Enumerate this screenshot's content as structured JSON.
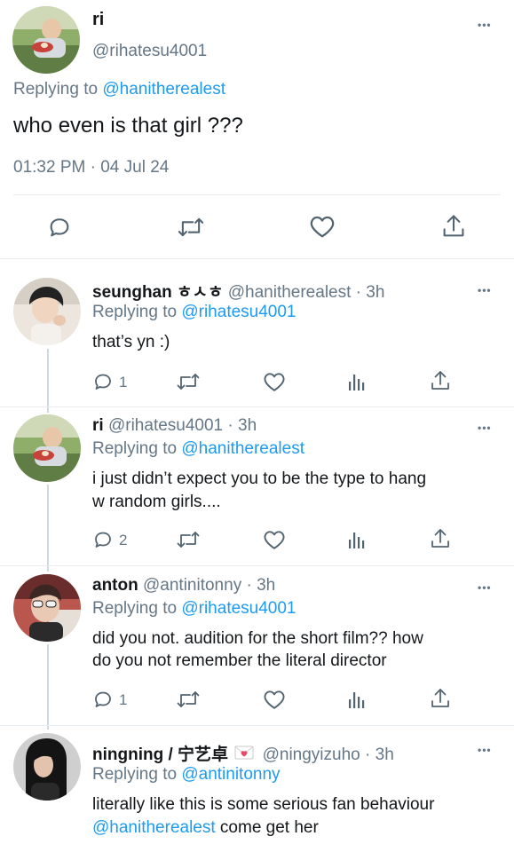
{
  "main_tweet": {
    "display_name": "ri",
    "handle": "@rihatesu4001",
    "replying_prefix": "Replying to",
    "replying_to": "@hanitherealest",
    "text": "who even is that girl ???",
    "timestamp": "01:32 PM · 04 Jul 24",
    "more": "•••"
  },
  "replies": [
    {
      "display_name": "seunghan ㅎㅅㅎ",
      "handle": "@hanitherealest",
      "time": "· 3h",
      "replying_prefix": "Replying to",
      "replying_to": "@rihatesu4001",
      "text": "that’s yn :)",
      "reply_count": "1",
      "more": "•••"
    },
    {
      "display_name": "ri",
      "handle": "@rihatesu4001",
      "time": "· 3h",
      "replying_prefix": "Replying to",
      "replying_to": "@hanitherealest",
      "text_lines": [
        "i just didn’t expect you to be the type to hang",
        "w random girls...."
      ],
      "reply_count": "2",
      "more": "•••"
    },
    {
      "display_name": "anton",
      "handle": "@antinitonny",
      "time": "· 3h",
      "replying_prefix": "Replying to",
      "replying_to": "@rihatesu4001",
      "text_lines": [
        "did you not. audition for the short film?? how",
        "do you not remember the literal director"
      ],
      "reply_count": "1",
      "more": "•••"
    },
    {
      "display_name": "ningning / 宁艺卓",
      "handle": "@ningyizuho",
      "time": "· 3h",
      "replying_prefix": "Replying to",
      "replying_to": "@antinitonny",
      "text_line1": "literally like this is some serious fan behaviour",
      "text_mention": "@hanitherealest",
      "text_line2_rest": " come get her",
      "more": "•••"
    }
  ],
  "colors": {
    "link": "#1d9bf0",
    "muted": "#657786",
    "text": "#14171a",
    "divider": "#e6ecf0"
  },
  "icons": [
    "reply-icon",
    "retweet-icon",
    "like-icon",
    "share-icon",
    "analytics-icon",
    "more-icon"
  ]
}
